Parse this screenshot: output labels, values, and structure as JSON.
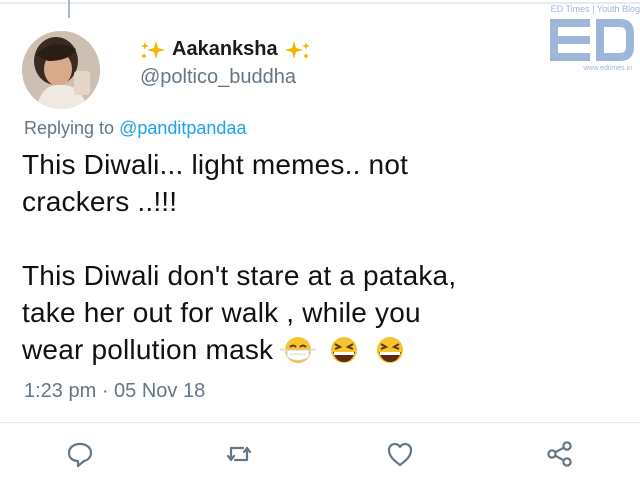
{
  "tweet": {
    "author_name": "Aakanksha",
    "handle": "@poltico_buddha",
    "replying_prefix": "Replying to",
    "replying_to": "@panditpandaa",
    "line1": "This Diwali... light memes.. not",
    "line2": "crackers ..!!!",
    "line3": "This Diwali don't stare at a pataka,",
    "line4": "take her out for walk , while you",
    "line5": "wear pollution mask",
    "timestamp": "1:23 pm · 05 Nov 18"
  },
  "watermark": {
    "top_text": "ED Times | Youth Blog",
    "url": "www.edtimes.in",
    "color": "#9fb6d8"
  },
  "icons": {
    "name_decoration": "sparkles-icon",
    "emojis": [
      "face-with-medical-mask-icon",
      "grinning-squinting-face-icon",
      "grinning-squinting-face-icon"
    ],
    "actions": [
      "reply-icon",
      "retweet-icon",
      "like-icon",
      "share-icon"
    ]
  },
  "colors": {
    "link": "#1da1f2",
    "secondary_text": "#657786",
    "icon": "#657786",
    "sparkle": "#f4b400"
  }
}
